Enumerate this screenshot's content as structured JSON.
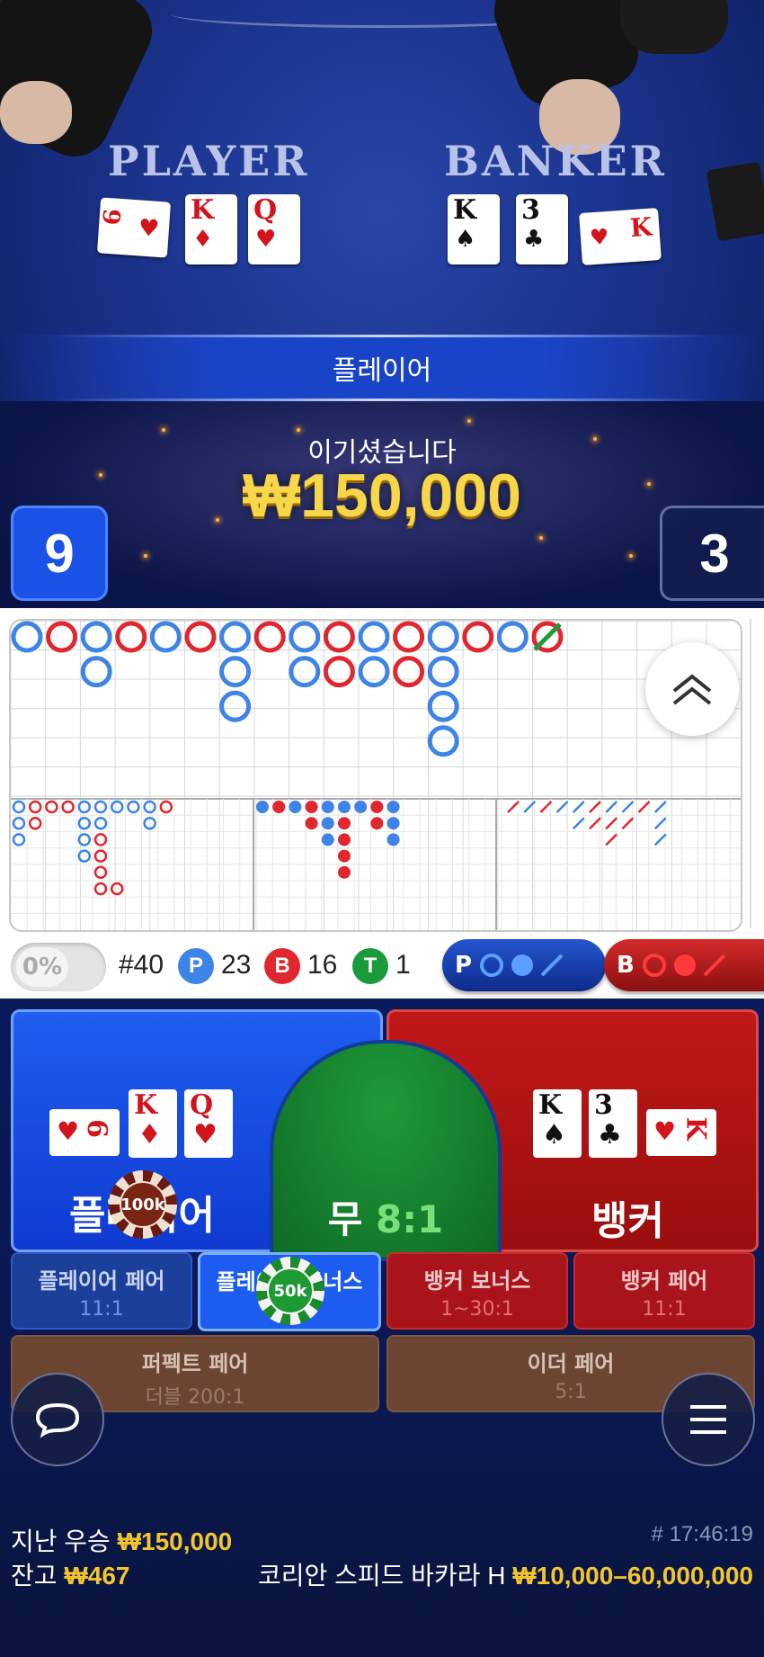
{
  "video": {
    "player_label": "PLAYER",
    "banker_label": "BANKER",
    "player_cards": [
      {
        "rank": "6",
        "suit": "♥",
        "color": "red"
      },
      {
        "rank": "K",
        "suit": "♦",
        "color": "red"
      },
      {
        "rank": "Q",
        "suit": "♥",
        "color": "red"
      }
    ],
    "banker_cards": [
      {
        "rank": "K",
        "suit": "♠",
        "color": "black"
      },
      {
        "rank": "3",
        "suit": "♣",
        "color": "black"
      },
      {
        "rank": "K",
        "suit": "♥",
        "color": "red"
      }
    ],
    "result_label": "플레이어",
    "win_text": "이기셨습니다",
    "win_amount": "₩150,000",
    "player_score": "9",
    "banker_score": "3"
  },
  "roadmap": {
    "colors": {
      "player": "#3d84e6",
      "banker": "#e0262e",
      "tie": "#1a9a3a"
    },
    "big_road": [
      [
        "P"
      ],
      [
        "B"
      ],
      [
        "P",
        "P"
      ],
      [
        "B"
      ],
      [
        "P"
      ],
      [
        "B"
      ],
      [
        "P",
        "P",
        "P"
      ],
      [
        "B"
      ],
      [
        "P",
        "P"
      ],
      [
        "B",
        "B"
      ],
      [
        "P",
        "P"
      ],
      [
        "B",
        "B"
      ],
      [
        "P",
        "P",
        "P",
        "P"
      ],
      [
        "B"
      ],
      [
        "P"
      ],
      [
        "B"
      ]
    ],
    "stats": {
      "percent": "0%",
      "round": "#40",
      "player_letter": "P",
      "player_count": "23",
      "banker_letter": "B",
      "banker_count": "16",
      "tie_letter": "T",
      "tie_count": "1"
    },
    "ask_player_label": "P",
    "ask_banker_label": "B"
  },
  "betting": {
    "player": {
      "label": "플레이어",
      "cards": [
        {
          "rank": "6",
          "suit": "♥",
          "color": "red"
        },
        {
          "rank": "K",
          "suit": "♦",
          "color": "red"
        },
        {
          "rank": "Q",
          "suit": "♥",
          "color": "red"
        }
      ],
      "chip": "100k"
    },
    "tie": {
      "label": "무",
      "odds": "8:1"
    },
    "banker": {
      "label": "뱅커",
      "cards": [
        {
          "rank": "K",
          "suit": "♠",
          "color": "black"
        },
        {
          "rank": "3",
          "suit": "♣",
          "color": "black"
        },
        {
          "rank": "K",
          "suit": "♥",
          "color": "red"
        }
      ]
    },
    "side_bets": [
      {
        "label": "플레이어 페어",
        "odds": "11:1"
      },
      {
        "label": "플레이어 보너스",
        "odds": "",
        "chip": "50k"
      },
      {
        "label": "뱅커 보너스",
        "odds": "1~30:1"
      },
      {
        "label": "뱅커 페어",
        "odds": "11:1"
      },
      {
        "label": "퍼펙트 페어",
        "odds": "더블 200:1"
      },
      {
        "label": "이더 페어",
        "odds": "5:1"
      }
    ]
  },
  "footer": {
    "last_win_label": "지난 우승",
    "last_win_amount": "₩150,000",
    "time": "# 17:46:19",
    "balance_label": "잔고",
    "balance_amount": "₩467",
    "table_name": "코리안 스피드 바카라 H",
    "limits": "₩10,000–60,000,000"
  }
}
